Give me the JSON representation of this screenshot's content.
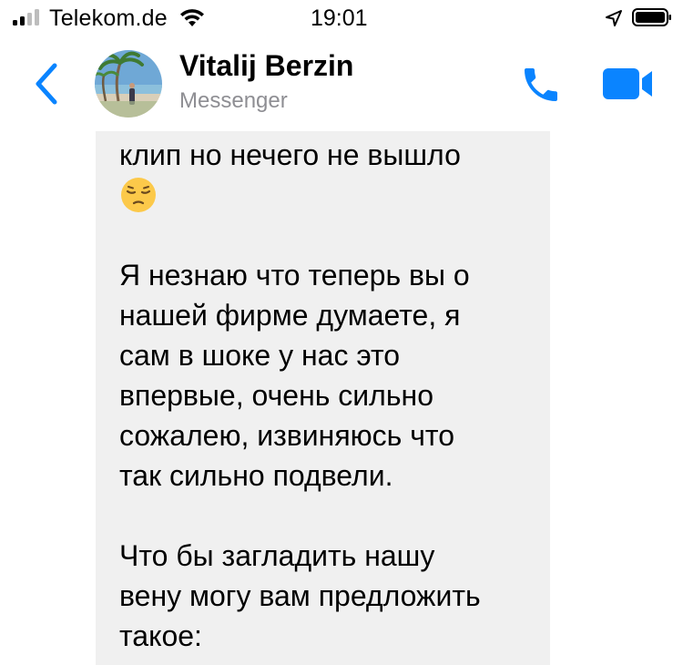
{
  "status_bar": {
    "carrier": "Telekom.de",
    "time": "19:01",
    "icons": [
      "signal-bars-icon",
      "wifi-icon",
      "location-arrow-icon",
      "battery-icon"
    ]
  },
  "header": {
    "contact_name": "Vitalij Berzin",
    "subtitle": "Messenger",
    "icons": [
      "back-chevron-icon",
      "phone-icon",
      "video-camera-icon"
    ],
    "accent_color": "#0a84ff"
  },
  "message": {
    "lines_1": [
      "клип но нечего не вышло"
    ],
    "emoji": "😔",
    "paragraph_2": [
      "Я незнаю что теперь вы о",
      "нашей фирме думаете, я",
      "сам в шоке у нас это",
      "впервые, очень сильно",
      "сожалею, извиняюсь что",
      "так сильно подвели."
    ],
    "paragraph_3": [
      "Что бы загладить нашу",
      "вену могу вам предложить",
      "такое:"
    ],
    "bubble_color": "#f0f0f0"
  }
}
